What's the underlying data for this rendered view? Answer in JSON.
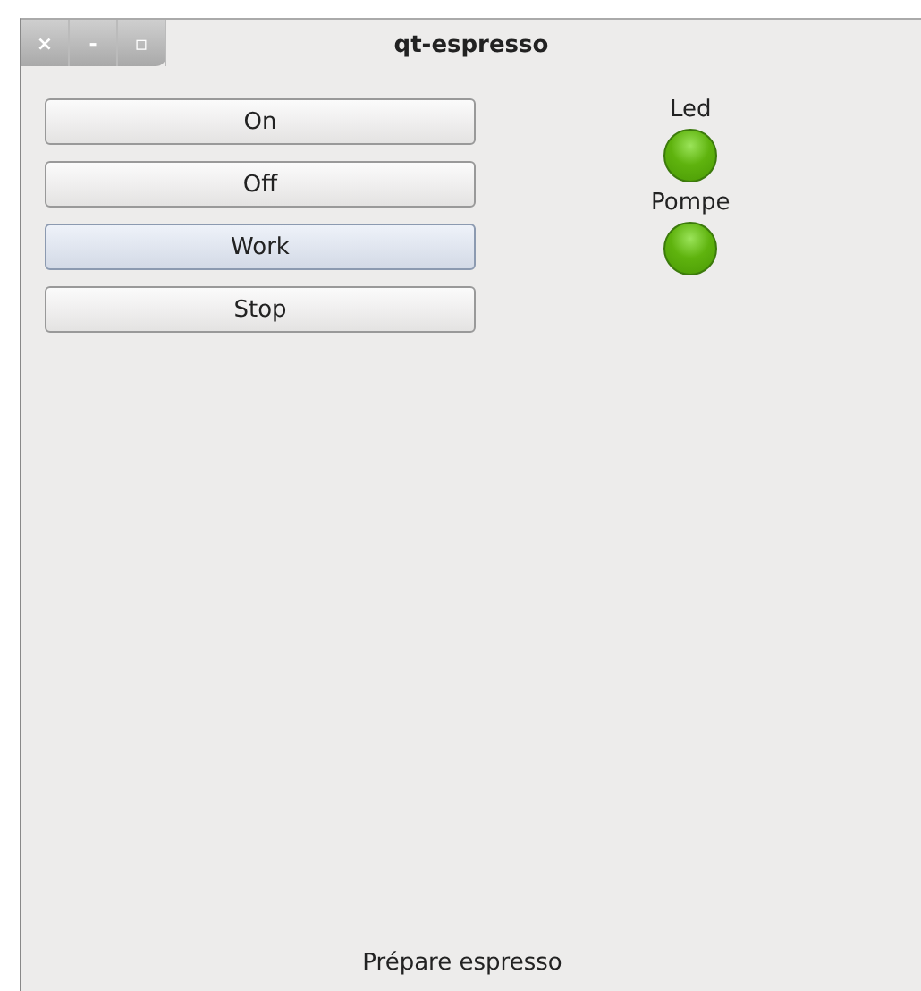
{
  "window": {
    "title": "qt-espresso",
    "controls": [
      "×",
      "-",
      "▫"
    ]
  },
  "buttons": [
    {
      "label": "On",
      "highlighted": false
    },
    {
      "label": "Off",
      "highlighted": false
    },
    {
      "label": "Work",
      "highlighted": true
    },
    {
      "label": "Stop",
      "highlighted": false
    }
  ],
  "indicators": [
    {
      "label": "Led",
      "on": true
    },
    {
      "label": "Pompe",
      "on": true
    }
  ],
  "status": "Prépare espresso"
}
